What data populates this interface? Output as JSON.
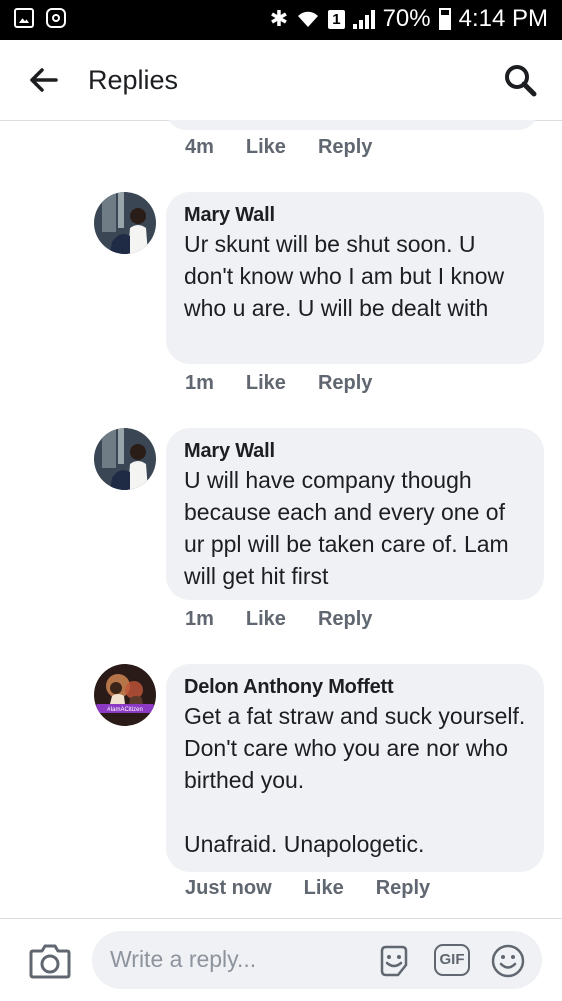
{
  "status_bar": {
    "battery": "70%",
    "time": "4:14 PM",
    "sim_slot": "1",
    "icons": [
      "gallery-icon",
      "instagram-icon",
      "bluetooth-icon",
      "wifi-icon",
      "signal-icon",
      "battery-icon"
    ]
  },
  "header": {
    "title": "Replies",
    "back_icon": "back-arrow-icon",
    "search_icon": "search-icon"
  },
  "previous_meta": {
    "time": "4m",
    "like": "Like",
    "reply": "Reply"
  },
  "comments": [
    {
      "author": "Mary Wall",
      "text": "Ur skunt will be shut soon. U don't know who I am but I know who u are. U will be dealt with",
      "time": "1m",
      "like": "Like",
      "reply": "Reply"
    },
    {
      "author": "Mary Wall",
      "text": "U will have company though because each and every one of ur ppl will be taken care of. Lam will get hit first",
      "time": "1m",
      "like": "Like",
      "reply": "Reply"
    },
    {
      "author": "Delon Anthony Moffett",
      "text": "Get a fat straw and suck yourself. Don't care who you are nor who birthed you.\n\nUnafraid. Unapologetic.",
      "time": "Just now",
      "like": "Like",
      "reply": "Reply",
      "avatar_badge": "#IamACitizen"
    }
  ],
  "composer": {
    "placeholder": "Write a reply...",
    "gif_label": "GIF",
    "icons": [
      "camera-icon",
      "sticker-icon",
      "gif-icon",
      "emoji-icon"
    ]
  },
  "colors": {
    "bubble": "#eff1f4",
    "text": "#1c1e21",
    "meta": "#606770",
    "placeholder": "#8d949e",
    "status_bar": "#000000"
  }
}
